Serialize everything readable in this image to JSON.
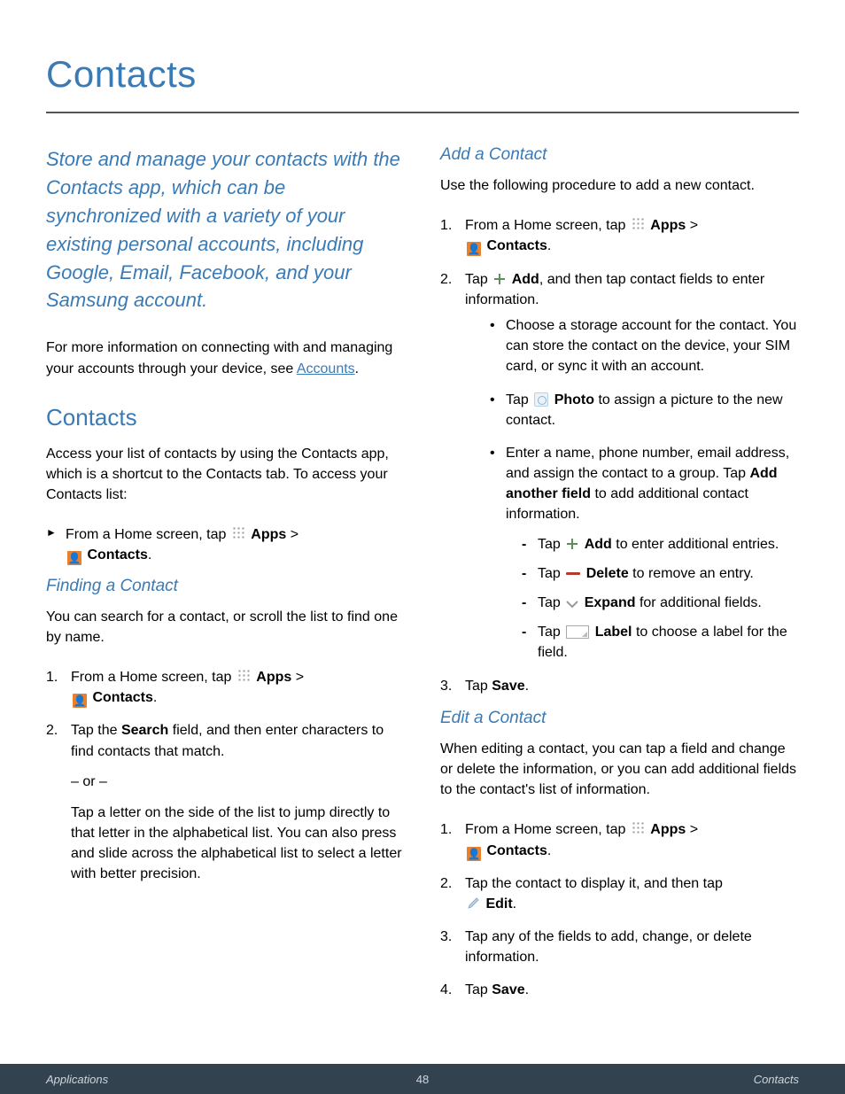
{
  "page_title": "Contacts",
  "lead": "Store and manage your contacts with the Contacts app, which can be synchronized with a variety of your existing personal accounts, including Google, Email, Facebook, and your Samsung account.",
  "intro_para_pre": "For more information on connecting with and managing your accounts through your device, see ",
  "intro_link": "Accounts",
  "intro_para_post": ".",
  "h2_contacts": "Contacts",
  "contacts_para": "Access your list of contacts by using the Contacts app, which is a shortcut to the Contacts tab. To access your Contacts list:",
  "step_home_pre": "From a Home screen, tap ",
  "apps_label": "Apps",
  "gt": " > ",
  "contacts_label": "Contacts",
  "period": ".",
  "h3_finding": "Finding a Contact",
  "finding_para": "You can search for a contact, or scroll the list to find one by name.",
  "finding_step2_pre": "Tap the ",
  "search_bold": "Search",
  "finding_step2_post": " field, and then enter characters to find contacts that match.",
  "or_text": "– or –",
  "finding_alt": "Tap a letter on the side of the list to jump directly to that letter in the alphabetical list. You can also press and slide across the alphabetical list to select a letter with better precision.",
  "h3_add": "Add a Contact",
  "add_para": "Use the following procedure to add a new contact.",
  "tap_word": "Tap ",
  "add_bold": "Add",
  "add_step2_post": ", and then tap contact fields to enter information.",
  "add_b1": "Choose a storage account for the contact. You can store the contact on the device, your SIM card, or sync it with an account.",
  "photo_bold": "Photo",
  "add_b2_post": " to assign a picture to the new contact.",
  "add_b3_pre": "Enter a name, phone number, email address, and assign the contact to a group. Tap ",
  "add_another_bold": "Add another field",
  "add_b3_post": " to add additional contact information.",
  "dash_add_post": " to enter additional entries.",
  "delete_bold": "Delete",
  "dash_delete_post": " to remove an entry.",
  "expand_bold": "Expand",
  "dash_expand_post": " for additional fields.",
  "label_bold": "Label",
  "dash_label_post": " to choose a label for the field.",
  "save_bold": "Save",
  "h3_edit": "Edit a Contact",
  "edit_para": "When editing a contact, you can tap a field and change or delete the information, or you can add additional fields to the contact's list of information.",
  "edit_step2_pre": "Tap the contact to display it, and then tap ",
  "edit_bold": "Edit",
  "edit_step3": "Tap any of the fields to add, change, or delete information.",
  "footer": {
    "left": "Applications",
    "center": "48",
    "right": "Contacts"
  }
}
